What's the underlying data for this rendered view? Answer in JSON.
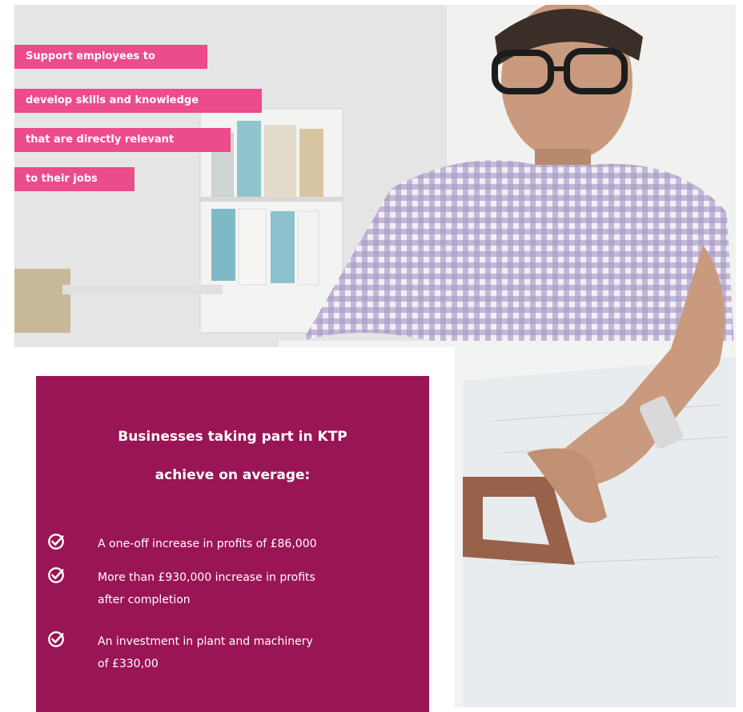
{
  "tagline": {
    "lines": [
      "Support employees to",
      "develop skills and knowledge",
      "that are directly relevant",
      "to their jobs"
    ]
  },
  "stats_card": {
    "title_line1": "Businesses taking part in KTP",
    "title_line2": "achieve on average:",
    "items": [
      {
        "icon": "check-circle-icon",
        "line1": "A one-off increase in profits of £86,000",
        "line2": ""
      },
      {
        "icon": "check-circle-icon",
        "line1": "More than £930,000 increase in profits",
        "line2": "after completion"
      },
      {
        "icon": "check-circle-icon",
        "line1": "An investment in plant and machinery",
        "line2": "of £330,00"
      }
    ]
  },
  "colors": {
    "tag_pink": "#ec4b8c",
    "card_magenta": "#9a1556",
    "text_white": "#ffffff"
  }
}
